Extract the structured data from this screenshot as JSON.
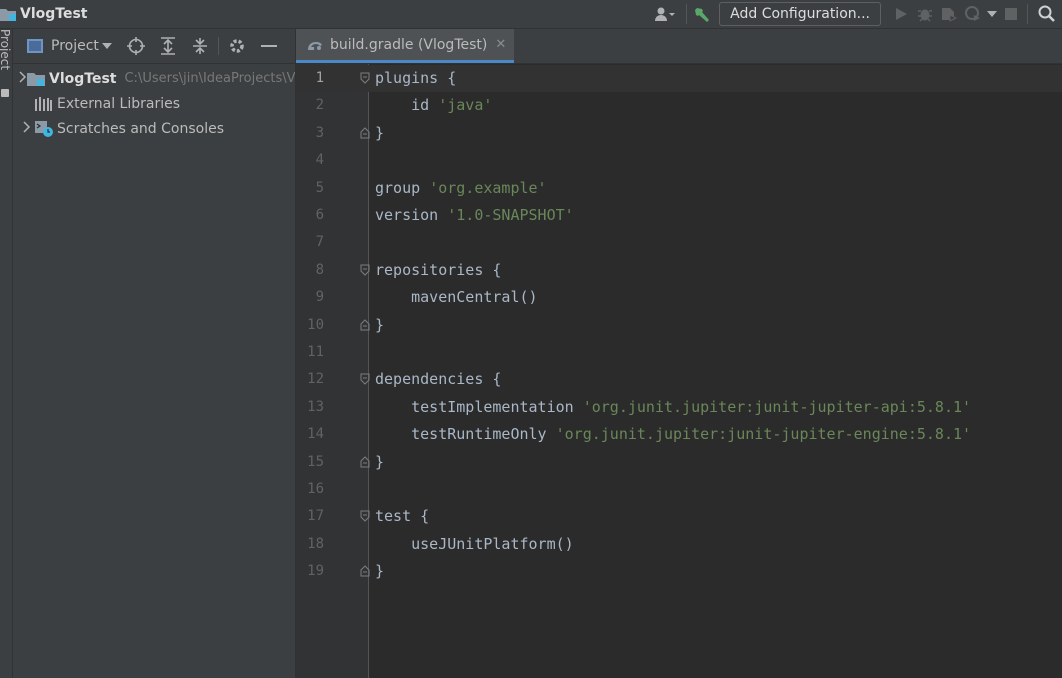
{
  "window": {
    "project_title": "VlogTest"
  },
  "toolbar": {
    "add_config_label": "Add Configuration...",
    "icons": [
      "user-icon",
      "build-hammer-icon",
      "run-icon",
      "debug-icon",
      "coverage-icon",
      "profile-icon",
      "stop-icon",
      "search-icon"
    ]
  },
  "side_strip": {
    "tab_label": "Project"
  },
  "project_panel": {
    "title": "Project",
    "tree": [
      {
        "label": "VlogTest",
        "path": "C:\\Users\\jin\\IdeaProjects\\VlogTest",
        "expandable": true
      },
      {
        "label": "External Libraries",
        "expandable": false
      },
      {
        "label": "Scratches and Consoles",
        "expandable": true
      }
    ]
  },
  "editor": {
    "tab_label": "build.gradle (VlogTest)",
    "current_line": 1,
    "lines": [
      {
        "n": "1",
        "text": "plugins {",
        "fold": "open"
      },
      {
        "n": "2",
        "text": "    id ",
        "str": "'java'"
      },
      {
        "n": "3",
        "text": "}",
        "fold": "close"
      },
      {
        "n": "4",
        "text": ""
      },
      {
        "n": "5",
        "text": "group ",
        "str": "'org.example'"
      },
      {
        "n": "6",
        "text": "version ",
        "str": "'1.0-SNAPSHOT'"
      },
      {
        "n": "7",
        "text": ""
      },
      {
        "n": "8",
        "text": "repositories {",
        "fold": "open"
      },
      {
        "n": "9",
        "text": "    mavenCentral()"
      },
      {
        "n": "10",
        "text": "}",
        "fold": "close"
      },
      {
        "n": "11",
        "text": ""
      },
      {
        "n": "12",
        "text": "dependencies {",
        "fold": "open"
      },
      {
        "n": "13",
        "text": "    testImplementation ",
        "str": "'org.junit.jupiter:junit-jupiter-api:5.8.1'"
      },
      {
        "n": "14",
        "text": "    testRuntimeOnly ",
        "str": "'org.junit.jupiter:junit-jupiter-engine:5.8.1'"
      },
      {
        "n": "15",
        "text": "}",
        "fold": "close"
      },
      {
        "n": "16",
        "text": ""
      },
      {
        "n": "17",
        "text": "test {",
        "fold": "open"
      },
      {
        "n": "18",
        "text": "    useJUnitPlatform()"
      },
      {
        "n": "19",
        "text": "}",
        "fold": "close"
      }
    ]
  },
  "colors": {
    "background": "#2b2b2b",
    "panel": "#3c3f41",
    "string": "#6a8759",
    "code": "#a9b7c6",
    "accent": "#4a88c7"
  }
}
